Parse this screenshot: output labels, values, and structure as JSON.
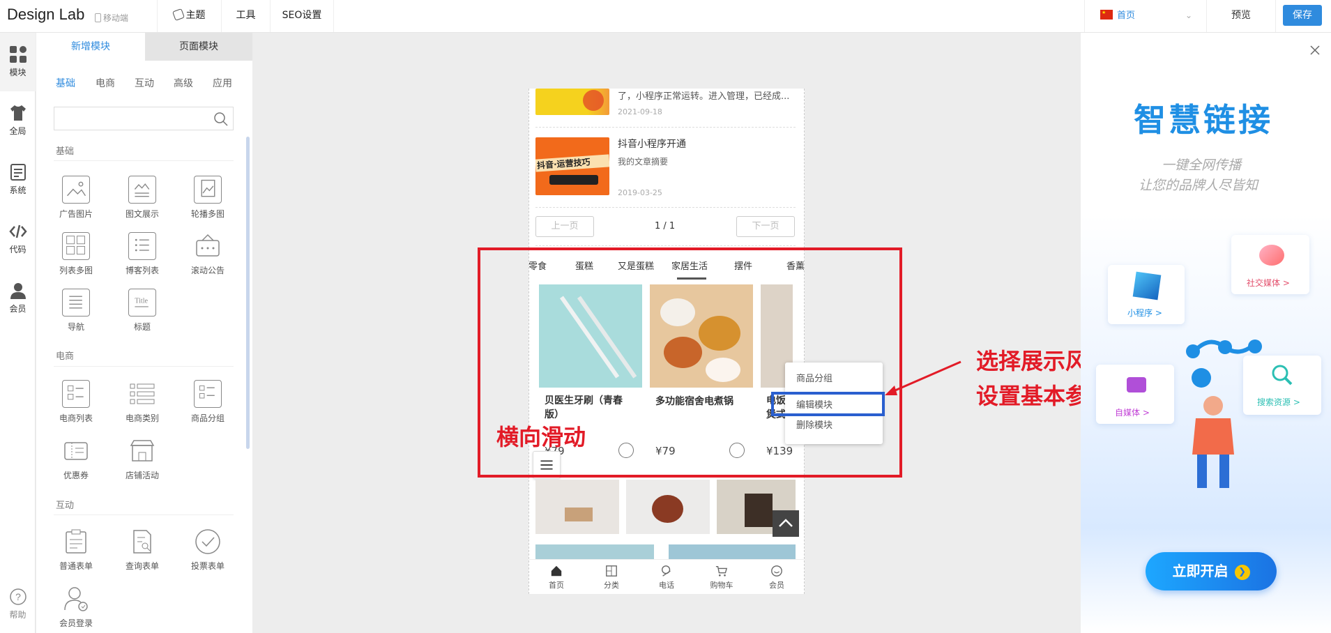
{
  "app": {
    "logo": "Design Lab",
    "mobile_tag": "移动端"
  },
  "topbar": {
    "menu": [
      "主题",
      "工具",
      "SEO设置"
    ],
    "page_select": "首页",
    "preview": "预览",
    "save": "保存"
  },
  "left_nav": [
    {
      "label": "模块",
      "icon": "grid-icon"
    },
    {
      "label": "全局",
      "icon": "shirt-icon"
    },
    {
      "label": "系统",
      "icon": "document-icon"
    },
    {
      "label": "代码",
      "icon": "code-icon"
    },
    {
      "label": "会员",
      "icon": "user-icon"
    }
  ],
  "help": "帮助",
  "panel": {
    "tab_active": "新增模块",
    "tab_other": "页面模块",
    "categories": [
      "基础",
      "电商",
      "互动",
      "高级",
      "应用"
    ],
    "sections": {
      "basic": "基础",
      "ecommerce": "电商",
      "interactive": "互动"
    },
    "basic_modules": [
      "广告图片",
      "图文展示",
      "轮播多图",
      "列表多图",
      "博客列表",
      "滚动公告",
      "导航",
      "标题"
    ],
    "ecom_modules": [
      "电商列表",
      "电商类别",
      "商品分组",
      "优惠券",
      "店铺活动"
    ],
    "interactive_modules": [
      "普通表单",
      "查询表单",
      "投票表单",
      "会员登录"
    ]
  },
  "phone": {
    "article1": {
      "snippet": "了，小程序正常运转。进入管理，已经成...",
      "date": "2021-09-18"
    },
    "article2": {
      "title": "抖音小程序开通",
      "summary": "我的文章摘要",
      "date": "2019-03-25",
      "thumb_text": "抖音·运营技巧"
    },
    "pagination": {
      "prev": "上一页",
      "page": "1 / 1",
      "next": "下一页"
    },
    "tabs": [
      "零食",
      "蛋糕",
      "又是蛋糕",
      "家居生活",
      "摆件",
      "香薰"
    ],
    "active_tab": "家居生活",
    "products": [
      {
        "name": "贝医生牙刷（青春版）",
        "price": "¥79"
      },
      {
        "name": "多功能宿舍电煮锅",
        "price": "¥79"
      },
      {
        "name": "电饭煲式",
        "price": "¥139"
      }
    ],
    "bottom_nav": [
      "首页",
      "分类",
      "电话",
      "购物车",
      "会员"
    ]
  },
  "context_menu": [
    "商品分组",
    "编辑模块",
    "删除模块"
  ],
  "annotations": {
    "horizontal": "横向滑动",
    "style_line1": "选择展示风格",
    "style_line2": "设置基本参数"
  },
  "promo": {
    "title": "智慧链接",
    "line1": "一键全网传播",
    "line2": "让您的品牌人尽皆知",
    "tags": [
      "小程序 >",
      "社交媒体 >",
      "自媒体 >",
      "搜索资源 >"
    ],
    "cta": "立即开启"
  },
  "colors": {
    "accent": "#2f8bde",
    "annotation": "#e21b27"
  }
}
